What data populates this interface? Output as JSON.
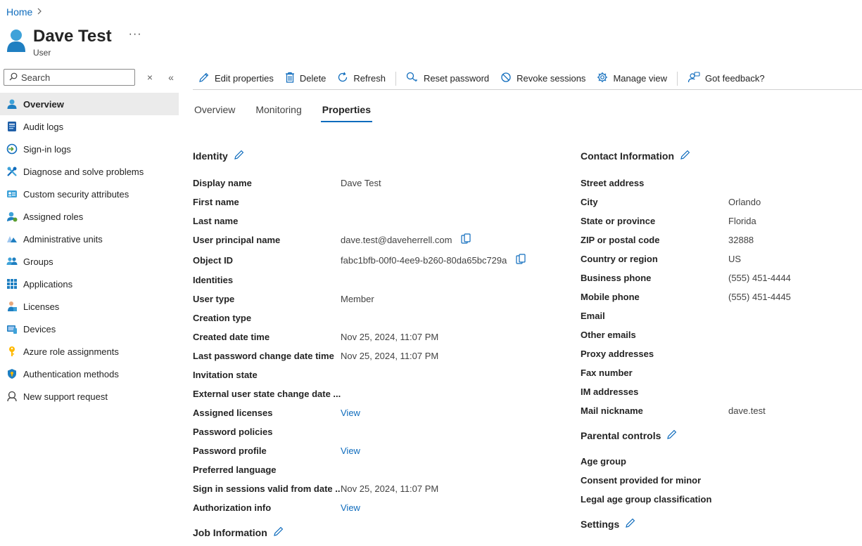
{
  "breadcrumb": {
    "home": "Home",
    "sep": "›"
  },
  "header": {
    "title": "Dave Test",
    "subtitle": "User",
    "more": "···"
  },
  "search": {
    "placeholder": "Search",
    "clear": "×",
    "collapse": "«"
  },
  "sidebar": {
    "items": [
      {
        "label": "Overview",
        "icon": "user-icon",
        "color": "#0f6cbd"
      },
      {
        "label": "Audit logs",
        "icon": "audit-log-icon",
        "color": "#0f6cbd"
      },
      {
        "label": "Sign-in logs",
        "icon": "sign-in-icon",
        "color": "#0f6cbd"
      },
      {
        "label": "Diagnose and solve problems",
        "icon": "wrench-icon",
        "color": "#0f6cbd"
      },
      {
        "label": "Custom security attributes",
        "icon": "id-card-icon",
        "color": "#0f6cbd"
      },
      {
        "label": "Assigned roles",
        "icon": "role-user-icon",
        "color": "#5c9e31"
      },
      {
        "label": "Administrative units",
        "icon": "admin-units-icon",
        "color": "#0f6cbd"
      },
      {
        "label": "Groups",
        "icon": "groups-icon",
        "color": "#0f6cbd"
      },
      {
        "label": "Applications",
        "icon": "grid-icon",
        "color": "#0f6cbd"
      },
      {
        "label": "Licenses",
        "icon": "license-icon",
        "color": "#0f6cbd"
      },
      {
        "label": "Devices",
        "icon": "device-icon",
        "color": "#0f6cbd"
      },
      {
        "label": "Azure role assignments",
        "icon": "key-icon",
        "color": "#ffb900"
      },
      {
        "label": "Authentication methods",
        "icon": "shield-icon",
        "color": "#0f6cbd"
      },
      {
        "label": "New support request",
        "icon": "support-icon",
        "color": "#424242"
      }
    ]
  },
  "toolbar": {
    "edit": "Edit properties",
    "delete": "Delete",
    "refresh": "Refresh",
    "reset_password": "Reset password",
    "revoke": "Revoke sessions",
    "manage_view": "Manage view",
    "feedback": "Got feedback?"
  },
  "tabs": {
    "overview": "Overview",
    "monitoring": "Monitoring",
    "properties": "Properties"
  },
  "identity": {
    "title": "Identity",
    "rows": [
      {
        "label": "Display name",
        "value": "Dave Test"
      },
      {
        "label": "First name",
        "value": ""
      },
      {
        "label": "Last name",
        "value": ""
      },
      {
        "label": "User principal name",
        "value": "dave.test@daveherrell.com"
      },
      {
        "label": "Object ID",
        "value": "fabc1bfb-00f0-4ee9-b260-80da65bc729a"
      },
      {
        "label": "Identities",
        "value": ""
      },
      {
        "label": "User type",
        "value": "Member"
      },
      {
        "label": "Creation type",
        "value": ""
      },
      {
        "label": "Created date time",
        "value": "Nov 25, 2024, 11:07 PM"
      },
      {
        "label": "Last password change date time",
        "value": "Nov 25, 2024, 11:07 PM"
      },
      {
        "label": "Invitation state",
        "value": ""
      },
      {
        "label": "External user state change date ...",
        "value": ""
      },
      {
        "label": "Assigned licenses",
        "value": "View"
      },
      {
        "label": "Password policies",
        "value": ""
      },
      {
        "label": "Password profile",
        "value": "View"
      },
      {
        "label": "Preferred language",
        "value": ""
      },
      {
        "label": "Sign in sessions valid from date ...",
        "value": "Nov 25, 2024, 11:07 PM"
      },
      {
        "label": "Authorization info",
        "value": "View"
      }
    ]
  },
  "job": {
    "title": "Job Information"
  },
  "contact": {
    "title": "Contact Information",
    "rows": [
      {
        "label": "Street address",
        "value": ""
      },
      {
        "label": "City",
        "value": "Orlando"
      },
      {
        "label": "State or province",
        "value": "Florida"
      },
      {
        "label": "ZIP or postal code",
        "value": "32888"
      },
      {
        "label": "Country or region",
        "value": "US"
      },
      {
        "label": "Business phone",
        "value": "(555) 451-4444"
      },
      {
        "label": "Mobile phone",
        "value": "(555) 451-4445"
      },
      {
        "label": "Email",
        "value": ""
      },
      {
        "label": "Other emails",
        "value": ""
      },
      {
        "label": "Proxy addresses",
        "value": ""
      },
      {
        "label": "Fax number",
        "value": ""
      },
      {
        "label": "IM addresses",
        "value": ""
      },
      {
        "label": "Mail nickname",
        "value": "dave.test"
      }
    ]
  },
  "parental": {
    "title": "Parental controls",
    "rows": [
      {
        "label": "Age group"
      },
      {
        "label": "Consent provided for minor"
      },
      {
        "label": "Legal age group classification"
      }
    ]
  },
  "settings": {
    "title": "Settings"
  },
  "colors": {
    "accent": "#0f6cbd",
    "text": "#242424",
    "active_bg": "#ebebeb"
  }
}
